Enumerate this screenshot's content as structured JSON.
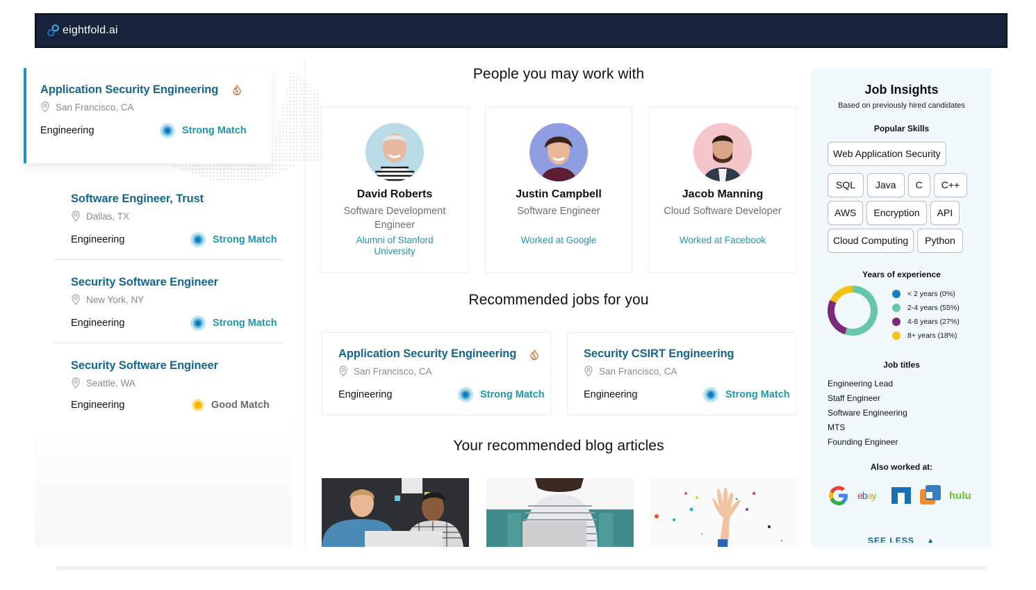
{
  "brand": {
    "name": "eightfold.ai"
  },
  "left_jobs": [
    {
      "title": "Application Security Engineering",
      "location": "San Francisco, CA",
      "department": "Engineering",
      "match": "Strong Match",
      "match_level": "strong",
      "hot": true,
      "active": true
    },
    {
      "title": "Software Engineer, Trust",
      "location": "Dallas, TX",
      "department": "Engineering",
      "match": "Strong Match",
      "match_level": "strong",
      "hot": false
    },
    {
      "title": "Security Software Engineer",
      "location": "New York, NY",
      "department": "Engineering",
      "match": "Strong Match",
      "match_level": "strong",
      "hot": false
    },
    {
      "title": "Security Software Engineer",
      "location": "Seattle, WA",
      "department": "Engineering",
      "match": "Good Match",
      "match_level": "good",
      "hot": false
    }
  ],
  "people": {
    "title": "People you may work with",
    "items": [
      {
        "name": "David Roberts",
        "role": "Software Development Engineer",
        "connection": "Alumni of Stanford University"
      },
      {
        "name": "Justin Campbell",
        "role": "Software Engineer",
        "connection": "Worked at Google"
      },
      {
        "name": "Jacob Manning",
        "role": "Cloud Software Developer",
        "connection": "Worked at Facebook"
      }
    ]
  },
  "recommended_jobs": {
    "title": "Recommended jobs for you",
    "items": [
      {
        "title": "Application Security Engineering",
        "location": "San Francisco, CA",
        "department": "Engineering",
        "match": "Strong Match",
        "hot": true
      },
      {
        "title": "Security CSIRT Engineering",
        "location": "San Francisco, CA",
        "department": "Engineering",
        "match": "Strong Match",
        "hot": false
      }
    ]
  },
  "blog": {
    "title": "Your recommended blog articles",
    "images": [
      "two-colleagues-at-laptop",
      "man-with-laptop-on-sofa",
      "hand-with-confetti"
    ]
  },
  "insights": {
    "title": "Job Insights",
    "subtitle": "Based on previously hired candidates",
    "skills_heading": "Popular Skills",
    "skills": [
      "Web Application Security",
      "SQL",
      "Java",
      "C",
      "C++",
      "AWS",
      "Encryption",
      "API",
      "Cloud Computing",
      "Python"
    ],
    "experience_heading": "Years of experience",
    "experience": [
      {
        "label": "< 2 years (0%)",
        "value": 0,
        "color": "#1a7fc1"
      },
      {
        "label": "2-4 years (55%)",
        "value": 55,
        "color": "#66c7ad"
      },
      {
        "label": "4-8 years (27%)",
        "value": 27,
        "color": "#7b2a7a"
      },
      {
        "label": "8+ years (18%)",
        "value": 18,
        "color": "#f2c315"
      }
    ],
    "titles_heading": "Job titles",
    "titles": [
      "Engineering Lead",
      "Staff Engineer",
      "Software Engineering",
      "MTS",
      "Founding Engineer"
    ],
    "worked_heading": "Also worked at:",
    "companies": [
      "google",
      "ebay",
      "netapp",
      "vmware",
      "hulu"
    ],
    "see_less": "SEE LESS"
  },
  "colors": {
    "accent": "#1f97ad",
    "title": "#15668e",
    "header": "#17233b"
  }
}
